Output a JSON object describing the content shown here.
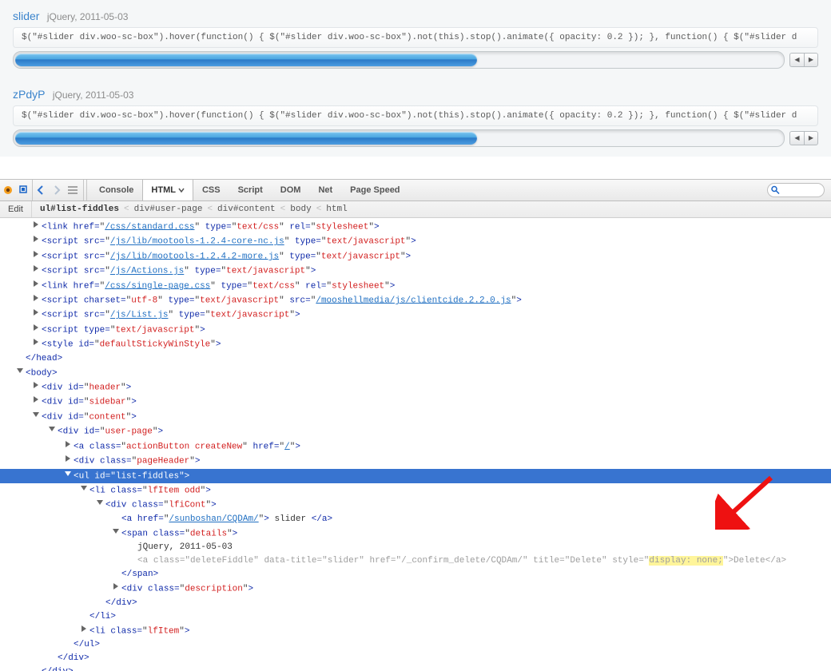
{
  "entries": [
    {
      "title": "slider",
      "meta": "jQuery, 2011-05-03",
      "desc": "$(\"#slider div.woo-sc-box\").hover(function() { $(\"#slider div.woo-sc-box\").not(this).stop().animate({ opacity: 0.2 }); }, function() { $(\"#slider d"
    },
    {
      "title": "zPdyP",
      "meta": "jQuery, 2011-05-03",
      "desc": "$(\"#slider div.woo-sc-box\").hover(function() { $(\"#slider div.woo-sc-box\").not(this).stop().animate({ opacity: 0.2 }); }, function() { $(\"#slider d"
    }
  ],
  "fb": {
    "tabs": {
      "console": "Console",
      "html": "HTML",
      "css": "CSS",
      "script": "Script",
      "dom": "DOM",
      "net": "Net",
      "pagespeed": "Page Speed"
    },
    "edit": "Edit",
    "crumbs": {
      "c1": "ul#list-fiddles",
      "c2": "div#user-page",
      "c3": "div#content",
      "c4": "body",
      "c5": "html"
    }
  },
  "tree": {
    "r1_1": "<link",
    "r1_href": "href=",
    "r1_href_v": "/css/standard.css",
    "r1_type": "type=",
    "r1_type_v": "text/css",
    "r1_rel": "rel=",
    "r1_rel_v": "stylesheet",
    "r1_end": ">",
    "r2_1": "<script",
    "r2_src": "src=",
    "r2_src_v": "/js/lib/mootools-1.2.4-core-nc.js",
    "r2_type": "type=",
    "r2_type_v": "text/javascript",
    "r2_end": ">",
    "r3_1": "<script",
    "r3_src": "src=",
    "r3_src_v": "/js/lib/mootools-1.2.4.2-more.js",
    "r3_type": "type=",
    "r3_type_v": "text/javascript",
    "r3_end": ">",
    "r4_1": "<script",
    "r4_src": "src=",
    "r4_src_v": "/js/Actions.js",
    "r4_type": "type=",
    "r4_type_v": "text/javascript",
    "r4_end": ">",
    "r5_1": "<link",
    "r5_href": "href=",
    "r5_href_v": "/css/single-page.css",
    "r5_type": "type=",
    "r5_type_v": "text/css",
    "r5_rel": "rel=",
    "r5_rel_v": "stylesheet",
    "r5_end": ">",
    "r6_1": "<script",
    "r6_cs": "charset=",
    "r6_cs_v": "utf-8",
    "r6_type": "type=",
    "r6_type_v": "text/javascript",
    "r6_src": "src=",
    "r6_src_v": "/mooshellmedia/js/clientcide.2.2.0.js",
    "r6_end": ">",
    "r7_1": "<script",
    "r7_src": "src=",
    "r7_src_v": "/js/List.js",
    "r7_type": "type=",
    "r7_type_v": "text/javascript",
    "r7_end": ">",
    "r8_1": "<script",
    "r8_type": "type=",
    "r8_type_v": "text/javascript",
    "r8_end": ">",
    "r9_1": "<style",
    "r9_id": "id=",
    "r9_id_v": "defaultStickyWinStyle",
    "r9_end": ">",
    "headClose": "</head>",
    "bodyOpen": "<body>",
    "divHeader_1": "<div",
    "divHeader_id": "id=",
    "divHeader_id_v": "header",
    "divHeader_end": ">",
    "divSidebar_1": "<div",
    "divSidebar_id": "id=",
    "divSidebar_id_v": "sidebar",
    "divSidebar_end": ">",
    "divContent_1": "<div",
    "divContent_id": "id=",
    "divContent_id_v": "content",
    "divContent_end": ">",
    "divUser_1": "<div",
    "divUser_id": "id=",
    "divUser_id_v": "user-page",
    "divUser_end": ">",
    "aCreate_1": "<a",
    "aCreate_cls": "class=",
    "aCreate_cls_v": "actionButton createNew",
    "aCreate_href": "href=",
    "aCreate_href_v": "/",
    "aCreate_end": ">",
    "divPh_1": "<div",
    "divPh_cls": "class=",
    "divPh_cls_v": "pageHeader",
    "divPh_end": ">",
    "ulOpen_1": "<ul",
    "ulOpen_id": "id=",
    "ulOpen_id_v": "list-fiddles",
    "ulOpen_end": ">",
    "liOdd_1": "<li",
    "liOdd_cls": "class=",
    "liOdd_cls_v": "lfItem odd",
    "liOdd_end": ">",
    "divLfi_1": "<div",
    "divLfi_cls": "class=",
    "divLfi_cls_v": "lfiCont",
    "divLfi_end": ">",
    "aSlider_1": "<a",
    "aSlider_href": "href=",
    "aSlider_href_v": "/sunboshan/CQDAm/",
    "aSlider_end": ">",
    "aSlider_txt": " slider ",
    "aSlider_close": "</a>",
    "spanDet_1": "<span",
    "spanDet_cls": "class=",
    "spanDet_cls_v": "details",
    "spanDet_end": ">",
    "detailsText": "jQuery, 2011-05-03",
    "aDel_1": "<a",
    "aDel_cls": "class=",
    "aDel_cls_v": "deleteFiddle",
    "aDel_dt": "data-title=",
    "aDel_dt_v": "slider",
    "aDel_href": "href=",
    "aDel_href_v": "/_confirm_delete/CQDAm/",
    "aDel_title": "title=",
    "aDel_title_v": "Delete",
    "aDel_style": "style=",
    "aDel_style_v": "display: none;",
    "aDel_end": ">",
    "aDel_txt": "Delete",
    "aDel_close": "</a>",
    "spanClose": "</span>",
    "divDesc_1": "<div",
    "divDesc_cls": "class=",
    "divDesc_cls_v": "description",
    "divDesc_end": ">",
    "divClose": "</div>",
    "liClose": "</li>",
    "li2_1": "<li",
    "li2_cls": "class=",
    "li2_cls_v": "lfItem",
    "li2_end": ">",
    "ulClose": "</ul>"
  }
}
